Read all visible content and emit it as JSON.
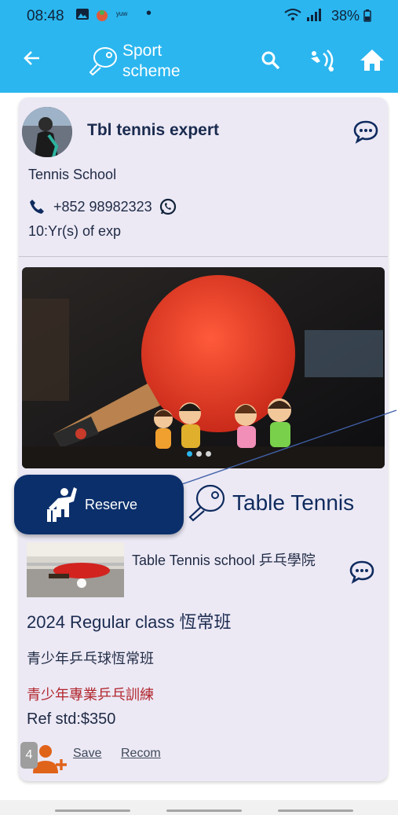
{
  "status_bar": {
    "time": "08:48",
    "notification_text": "ʸᵘʷ",
    "battery": "38%"
  },
  "app_bar": {
    "title_line1": "Sport",
    "title_line2": "scheme"
  },
  "expert": {
    "name": "Tbl tennis expert",
    "school": "Tennis School",
    "phone": "+852 98982323",
    "experience": "10:Yr(s) of exp"
  },
  "reserve_button": {
    "label": "Reserve"
  },
  "sport": {
    "name": "Table Tennis"
  },
  "listing": {
    "school_name": "Table Tennis school 乒乓學院",
    "class_title": "2024 Regular class 恆常班",
    "class_subtitle": "青少年乒乓球恆常班",
    "class_description": "青少年專業乒乓訓練",
    "reference_price": "Ref std:$350",
    "participant_count": "4",
    "save_label": "Save",
    "recommend_label": "Recom"
  },
  "colors": {
    "accent": "#2bb6ef",
    "primary": "#0b2f6b",
    "card_bg": "#ece9f5",
    "alert_text": "#b2262d"
  },
  "icons": [
    "arrow-back-icon",
    "ping-pong-icon",
    "search-icon",
    "signal-wave-icon",
    "home-icon",
    "chat-bubble-icon",
    "phone-icon",
    "whatsapp-icon",
    "raise-hand-icon",
    "person-add-icon"
  ]
}
